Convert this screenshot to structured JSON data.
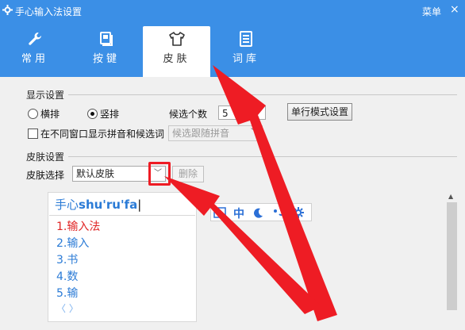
{
  "window": {
    "title": "手心输入法设置",
    "menu": "菜单",
    "close": "×"
  },
  "tabs": [
    {
      "label": "常用",
      "icon": "wrench-icon"
    },
    {
      "label": "按键",
      "icon": "key-icon"
    },
    {
      "label": "皮肤",
      "icon": "tshirt-icon",
      "active": true
    },
    {
      "label": "词库",
      "icon": "book-icon"
    }
  ],
  "display": {
    "section_title": "显示设置",
    "horizontal": "横排",
    "vertical": "竖排",
    "vertical_selected": true,
    "candidate_count_label": "候选个数",
    "candidate_count_value": "5",
    "single_line_button": "单行模式设置",
    "show_pinyin_label": "在不同窗口显示拼音和候选词",
    "show_pinyin_checked": false,
    "candidate_follow": "候选跟随拼音"
  },
  "skin": {
    "section_title": "皮肤设置",
    "select_label": "皮肤选择",
    "selected_skin": "默认皮肤",
    "delete_button": "删除"
  },
  "preview": {
    "composition_prefix": "手心",
    "composition_pinyin": "shu'ru'fa",
    "candidates": [
      "1.输入法",
      "2.输入",
      "3.书",
      "4.数",
      "5.输"
    ],
    "nav": "〈 〉",
    "toolbar_text": "中"
  },
  "colors": {
    "accent": "#3b8fe6",
    "candidate_first": "#e02424",
    "candidate": "#2b7bd6",
    "arrow": "#ee1c24"
  }
}
